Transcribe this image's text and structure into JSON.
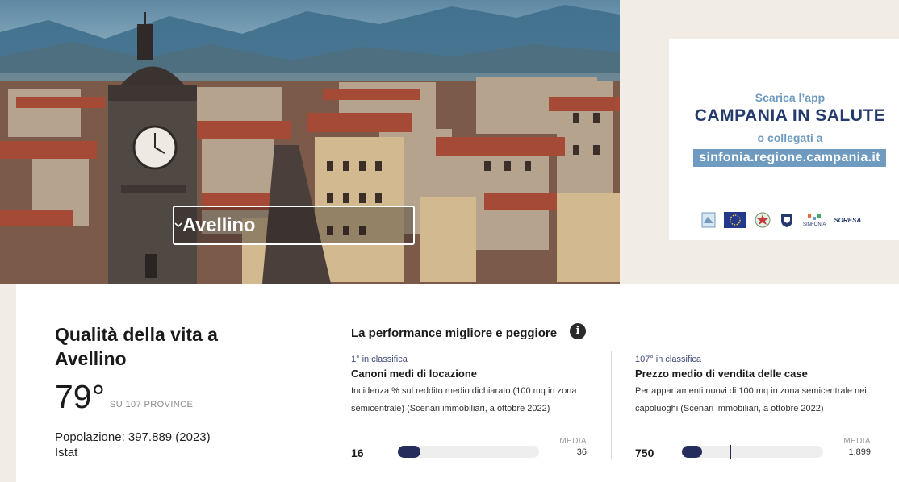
{
  "hero": {
    "city_selected": "Avellino"
  },
  "ad": {
    "line1": "Scarica l’app",
    "line2": "CAMPANIA IN SALUTE",
    "line3": "o collegati a",
    "url": "sinfonia.regione.campania.it",
    "logos": [
      "eu-flag",
      "italy-emblem",
      "campania-emblem",
      "sinfonia",
      "soresa"
    ],
    "logo_labels": [
      "SINFONIA",
      "SORESA"
    ]
  },
  "card": {
    "title": "Qualità della vita a Avellino",
    "rank": "79°",
    "rank_sub": "SU 107 PROVINCE",
    "population": "Popolazione: 397.889 (2023) Istat",
    "performance_title": "La performance migliore e peggiore",
    "metrics": [
      {
        "rank": "1° in classifica",
        "title": "Canoni medi di locazione",
        "description": "Incidenza % sul reddito medio dichiarato (100 mq in zona semicentrale) (Scenari immobiliari, a ottobre 2022)",
        "media_label": "MEDIA",
        "value": "16",
        "average": "36",
        "value_num": 16,
        "fill_fraction": 0.16,
        "average_fraction": 0.36
      },
      {
        "rank": "107° in classifica",
        "title": "Prezzo medio di vendita delle case",
        "description": "Per appartamenti nuovi di 100 mq in zona semicentrale nei capoluoghi (Scenari immobiliari, a ottobre 2022)",
        "media_label": "MEDIA",
        "value": "750",
        "average": "1.899",
        "value_num": 750,
        "fill_fraction": 0.14,
        "average_fraction": 0.34
      }
    ]
  },
  "colors": {
    "accent_dark": "#252d5c",
    "ad_blue": "#6f9bc1",
    "ad_navy": "#253b6e"
  }
}
